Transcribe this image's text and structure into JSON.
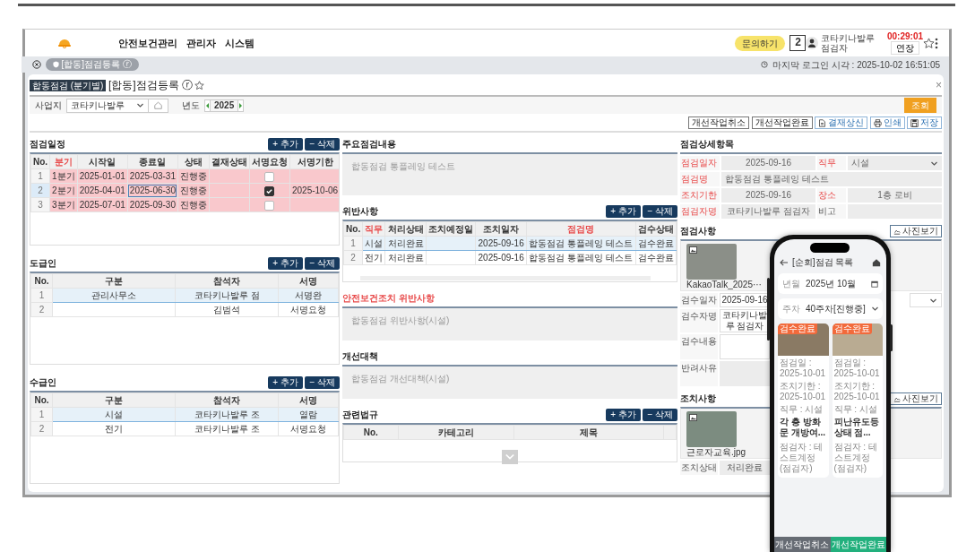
{
  "header": {
    "nav": [
      {
        "label": "안전보건관리"
      },
      {
        "label": "관리자"
      },
      {
        "label": "시스템"
      }
    ],
    "inquiry_button": "문의하기",
    "calendar_badge": "2",
    "user": {
      "name": "코타키나발루",
      "role": "점검자"
    },
    "session_timer": "00:29:01",
    "extend_button": "연장"
  },
  "tab_bar": {
    "tabs": [
      {
        "label": "[합동]점검등록 ⓡ",
        "selected": true
      }
    ],
    "last_login": "마지막 로그인 시각 : 2025-10-02 16:51:05"
  },
  "page": {
    "badge": "합동점검 (분기별)",
    "title": "[합동]점검등록 ⓡ",
    "close": "×"
  },
  "search": {
    "site_label": "사업지",
    "site_value": "코타키나발루",
    "year_label": "년도",
    "year_value": "2025",
    "search_button": "조회"
  },
  "actions": [
    {
      "label": "개선작업취소",
      "kind": "plain"
    },
    {
      "label": "개선작업완료",
      "kind": "plain"
    },
    {
      "label": "결재상신",
      "kind": "document"
    },
    {
      "label": "인쇄",
      "kind": "print"
    },
    {
      "label": "저장",
      "kind": "save"
    }
  ],
  "schedule": {
    "title": "점검일정",
    "add_button": "+ 추가",
    "delete_button": "− 삭제",
    "columns": [
      {
        "label": "No.",
        "required": false
      },
      {
        "label": "분기",
        "required": true
      },
      {
        "label": "시작일",
        "required": false
      },
      {
        "label": "종료일",
        "required": false
      },
      {
        "label": "상태",
        "required": false
      },
      {
        "label": "결재상태",
        "required": false
      },
      {
        "label": "서명요청",
        "required": false
      },
      {
        "label": "서명기한",
        "required": false
      }
    ],
    "rows": [
      {
        "no": "1",
        "quarter": "1분기",
        "start": "2025-01-01",
        "end": "2025-03-31",
        "status": "진행중",
        "sign_requested": false,
        "selected": false
      },
      {
        "no": "2",
        "quarter": "2분기",
        "start": "2025-04-01",
        "end": "2025-06-30",
        "status": "진행중",
        "sign_requested": true,
        "sign_deadline": "2025-10-06",
        "selected": true
      },
      {
        "no": "3",
        "quarter": "3분기",
        "start": "2025-07-01",
        "end": "2025-09-30",
        "status": "진행중",
        "sign_requested": false,
        "selected": false
      }
    ]
  },
  "contractor": {
    "title": "도급인",
    "add_button": "+ 추가",
    "delete_button": "− 삭제",
    "columns": [
      "No.",
      "구분",
      "참석자",
      "서명"
    ],
    "rows": [
      {
        "no": "1",
        "division": "관리사무소",
        "attendee": "코타키나발루 점",
        "sign": "서명완",
        "selected": true
      },
      {
        "no": "2",
        "attendee": "김범석",
        "sign": "서명요청",
        "selected": false
      }
    ]
  },
  "subcontractor": {
    "title": "수급인",
    "add_button": "+ 추가",
    "delete_button": "− 삭제",
    "columns": [
      "No.",
      "구분",
      "참석자",
      "서명"
    ],
    "rows": [
      {
        "no": "1",
        "division": "시설",
        "attendee": "코타키나발루 조",
        "sign": "열람",
        "selected": true
      },
      {
        "no": "2",
        "division": "전기",
        "attendee": "코타키나발루 조",
        "sign": "서명요청",
        "selected": false
      }
    ]
  },
  "main_content": {
    "title": "주요점검내용",
    "value": "합동점검 통플레잉 테스트"
  },
  "violations": {
    "title": "위반사항",
    "add_button": "+ 추가",
    "delete_button": "− 삭제",
    "columns": [
      {
        "label": "No.",
        "required": false
      },
      {
        "label": "직무",
        "required": true
      },
      {
        "label": "처리상태",
        "required": false
      },
      {
        "label": "조치예정일",
        "required": false
      },
      {
        "label": "조치일자",
        "required": false
      },
      {
        "label": "점검명",
        "required": true
      },
      {
        "label": "검수상태",
        "required": false
      }
    ],
    "rows": [
      {
        "no": "1",
        "duty": "시설",
        "process": "처리완료",
        "action_date": "2025-09-16",
        "name": "합동점검 통플레잉 테스트",
        "review": "검수완료",
        "selected": true
      },
      {
        "no": "2",
        "duty": "전기",
        "process": "처리완료",
        "action_date": "2025-09-16",
        "name": "합동점검 통플레잉 테스트",
        "review": "검수완료",
        "selected": false
      }
    ]
  },
  "safety_violation": {
    "title": "안전보건조치 위반사항",
    "required": true,
    "value": "합동점검 위반사항(시설)"
  },
  "improvement": {
    "title": "개선대책",
    "required": false,
    "value": "합동점검 개선대책(시설)"
  },
  "regulations": {
    "title": "관련법규",
    "add_button": "+ 추가",
    "delete_button": "− 삭제",
    "columns": [
      "No.",
      "카테고리",
      "제목"
    ]
  },
  "detail": {
    "title": "점검상세항목",
    "rows": [
      [
        {
          "label": "점검일자",
          "required": true,
          "value": "2025-09-16",
          "kind": "text"
        },
        {
          "label": "직무",
          "required": true,
          "value": "시설",
          "kind": "select"
        }
      ],
      [
        {
          "label": "점검명",
          "required": true,
          "value": "합동점검 통플레잉 테스트",
          "kind": "text"
        }
      ],
      [
        {
          "label": "조치기한",
          "required": true,
          "value": "2025-09-16",
          "kind": "text"
        },
        {
          "label": "장소",
          "required": true,
          "value": "1층 로비",
          "kind": "text"
        }
      ],
      [
        {
          "label": "점검자명",
          "required": true,
          "value": "코타키나발루 점검자",
          "kind": "text"
        },
        {
          "label": "비고",
          "required": false,
          "kind": "text"
        }
      ]
    ]
  },
  "inspection": {
    "title": "점검사항",
    "photo_button": "사진보기",
    "photos": [
      {
        "filename": "KakaoTalk_2025···"
      }
    ],
    "fields": [
      {
        "label": "검수일자",
        "value": "2025-09-16",
        "kind": "pair"
      },
      {
        "label": "검수자명",
        "value": "코타키나발루 점검자",
        "kind": "text"
      },
      {
        "label": "검수내용",
        "kind": "textarea"
      },
      {
        "label": "반려사유",
        "kind": "readonly"
      }
    ]
  },
  "action_taken": {
    "title": "조치사항",
    "photo_button": "사진보기",
    "photos": [
      {
        "filename": "근로자교육.jpg"
      }
    ],
    "fields": [
      {
        "label": "조치상태",
        "value": "처리완료",
        "kind": "readonly"
      }
    ]
  },
  "phone": {
    "title": "[순회]점검 목록",
    "filters": [
      {
        "label": "년월",
        "value": "2025년 10월",
        "kind": "date"
      },
      {
        "label": "주차",
        "value": "40주차[진행중]",
        "kind": "select"
      }
    ],
    "cards": [
      {
        "badge": "검수완료",
        "lines": [
          "점검일 : 2025-10-01",
          "조치기한 : 2025-10-01",
          "직무 : 시설"
        ],
        "title": "각 층 방화문 개방여...",
        "inspector": "점검자 : 테스트계정(점검자)"
      },
      {
        "badge": "검수완료",
        "lines": [
          "점검일 : 2025-10-01",
          "조치기한 : 2025-10-01",
          "직무 : 시설"
        ],
        "title": "피난유도등 상태 점...",
        "inspector": "점검자 : 테스트계정(점검자)"
      }
    ],
    "buttons": [
      {
        "label": "개선작업취소",
        "kind": "secondary"
      },
      {
        "label": "개선작업완료",
        "kind": "primary"
      }
    ]
  }
}
